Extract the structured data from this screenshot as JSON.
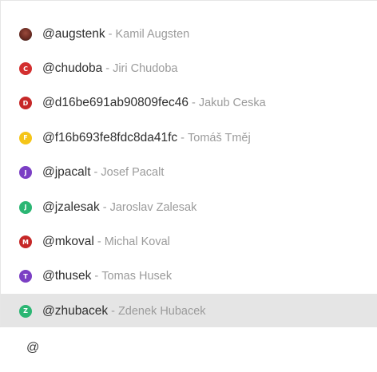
{
  "mentions": [
    {
      "letter": "",
      "avatar_color": "#7a3128",
      "handle": "@augstenk",
      "separator": "-",
      "name": "Kamil Augsten",
      "selected": false
    },
    {
      "letter": "C",
      "avatar_color": "#d32f2f",
      "handle": "@chudoba",
      "separator": "-",
      "name": "Jiri Chudoba",
      "selected": false
    },
    {
      "letter": "D",
      "avatar_color": "#c62828",
      "handle": "@d16be691ab90809fec46",
      "separator": "-",
      "name": "Jakub Ceska",
      "selected": false
    },
    {
      "letter": "F",
      "avatar_color": "#f5c518",
      "handle": "@f16b693fe8fdc8da41fc",
      "separator": "-",
      "name": "Tomáš Tměj",
      "selected": false
    },
    {
      "letter": "J",
      "avatar_color": "#7b3fc4",
      "handle": "@jpacalt",
      "separator": "-",
      "name": "Josef Pacalt",
      "selected": false
    },
    {
      "letter": "J",
      "avatar_color": "#2bb673",
      "handle": "@jzalesak",
      "separator": "-",
      "name": "Jaroslav Zalesak",
      "selected": false
    },
    {
      "letter": "M",
      "avatar_color": "#c62828",
      "handle": "@mkoval",
      "separator": "-",
      "name": "Michal Koval",
      "selected": false
    },
    {
      "letter": "T",
      "avatar_color": "#7b3fc4",
      "handle": "@thusek",
      "separator": "-",
      "name": "Tomas Husek",
      "selected": false
    },
    {
      "letter": "Z",
      "avatar_color": "#2bb673",
      "handle": "@zhubacek",
      "separator": "-",
      "name": "Zdenek Hubacek",
      "selected": true
    }
  ],
  "input": {
    "value": "@"
  }
}
